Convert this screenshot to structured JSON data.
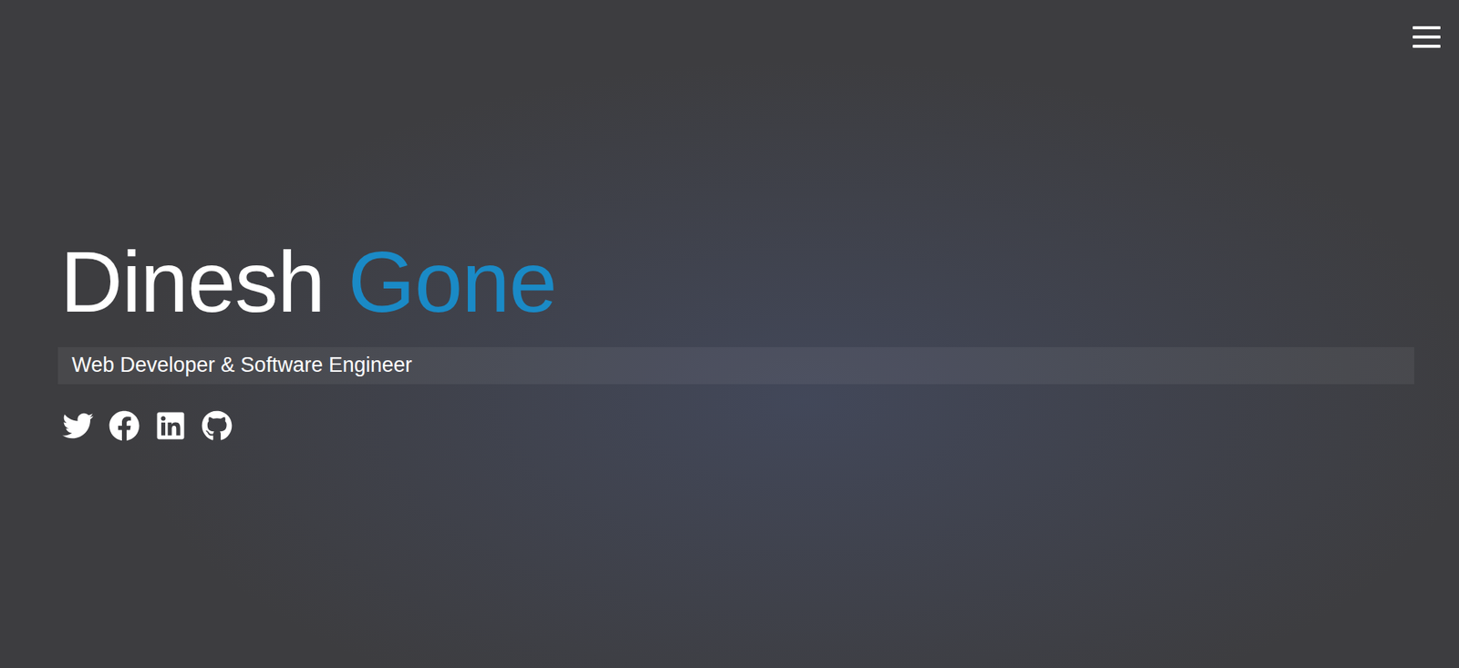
{
  "hero": {
    "first_name": "Dinesh",
    "last_name": "Gone",
    "subtitle": "Web Developer & Software Engineer"
  }
}
